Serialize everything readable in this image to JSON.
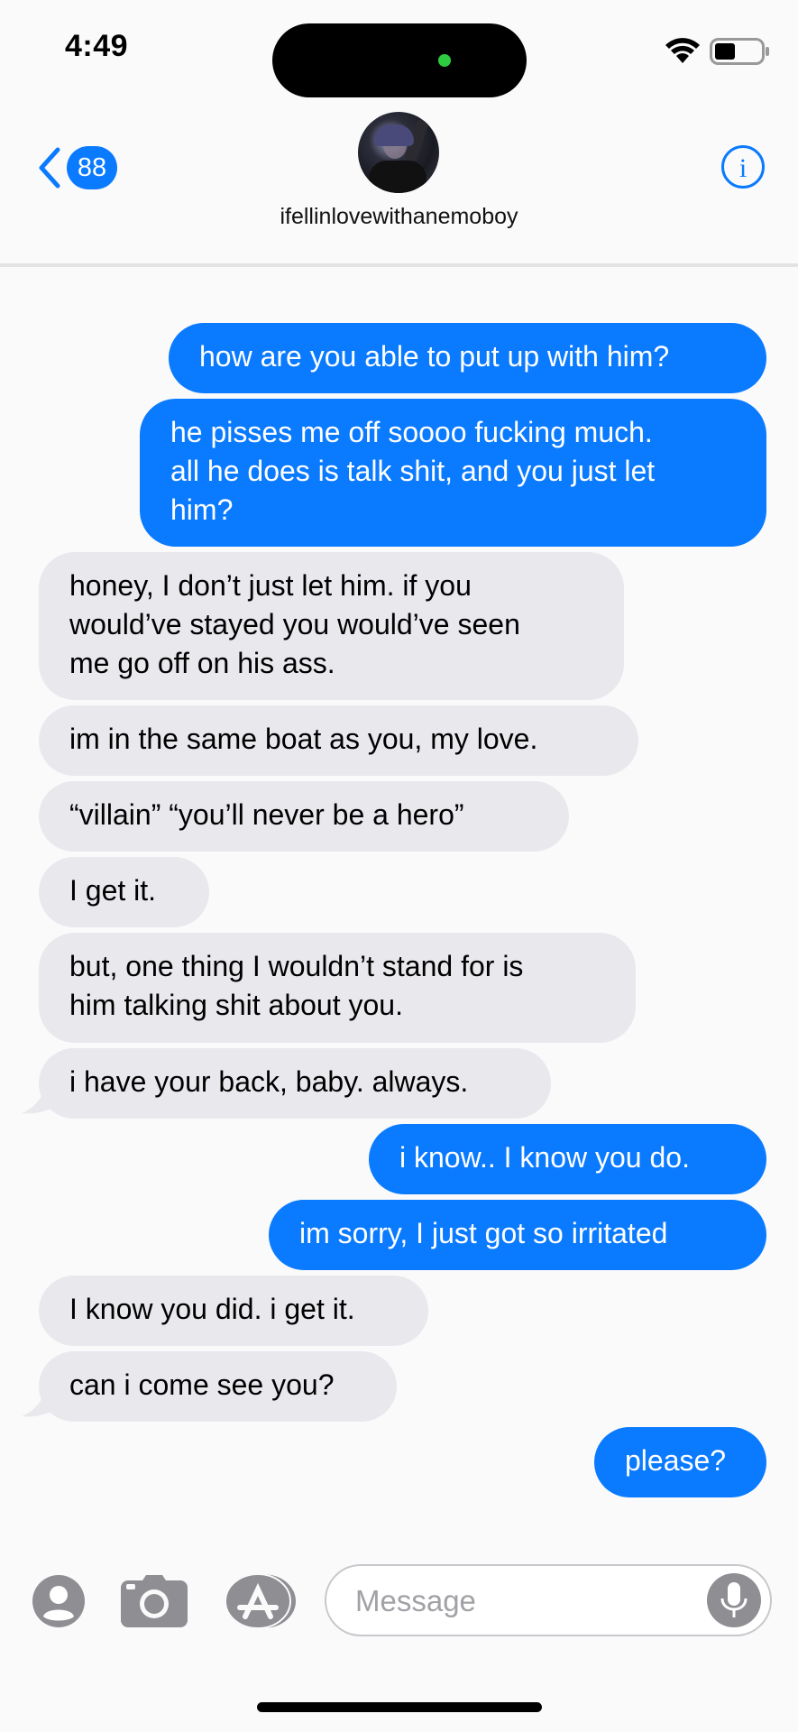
{
  "status": {
    "time": "4:49"
  },
  "header": {
    "back_count": "88",
    "contact_name": "ifellinlovewithanemoboy"
  },
  "messages": [
    {
      "side": "sent",
      "text": "how are you able to put up with him?"
    },
    {
      "side": "sent",
      "text": "he pisses me off soooo fucking much.\nall he does is talk shit, and you just let\nhim?"
    },
    {
      "side": "recv",
      "text": "honey, I don’t just let him. if you\nwould’ve stayed you would’ve seen\nme go off on his ass."
    },
    {
      "side": "recv",
      "text": "im in the same boat as you, my love."
    },
    {
      "side": "recv",
      "text": "“villain” “you’ll never be a hero”"
    },
    {
      "side": "recv",
      "text": "I get it."
    },
    {
      "side": "recv",
      "text": "but, one thing I wouldn’t stand for is\nhim talking shit about you."
    },
    {
      "side": "recv",
      "text": "i have your back, baby. always."
    },
    {
      "side": "sent",
      "text": "i know.. I know you do."
    },
    {
      "side": "sent",
      "text": "im sorry, I just got so irritated"
    },
    {
      "side": "recv",
      "text": "I know you did. i get it."
    },
    {
      "side": "recv",
      "text": "can i come see you?"
    },
    {
      "side": "sent",
      "text": "please?"
    }
  ],
  "composer": {
    "placeholder": "Message"
  },
  "colors": {
    "sent_bubble": "#0a7aff",
    "received_bubble": "#e9e8ed",
    "accent": "#0a7aff"
  },
  "icons": [
    "chevron-left-icon",
    "info-icon",
    "wifi-icon",
    "battery-icon",
    "contacts-icon",
    "camera-icon",
    "app-store-icon",
    "microphone-icon"
  ]
}
